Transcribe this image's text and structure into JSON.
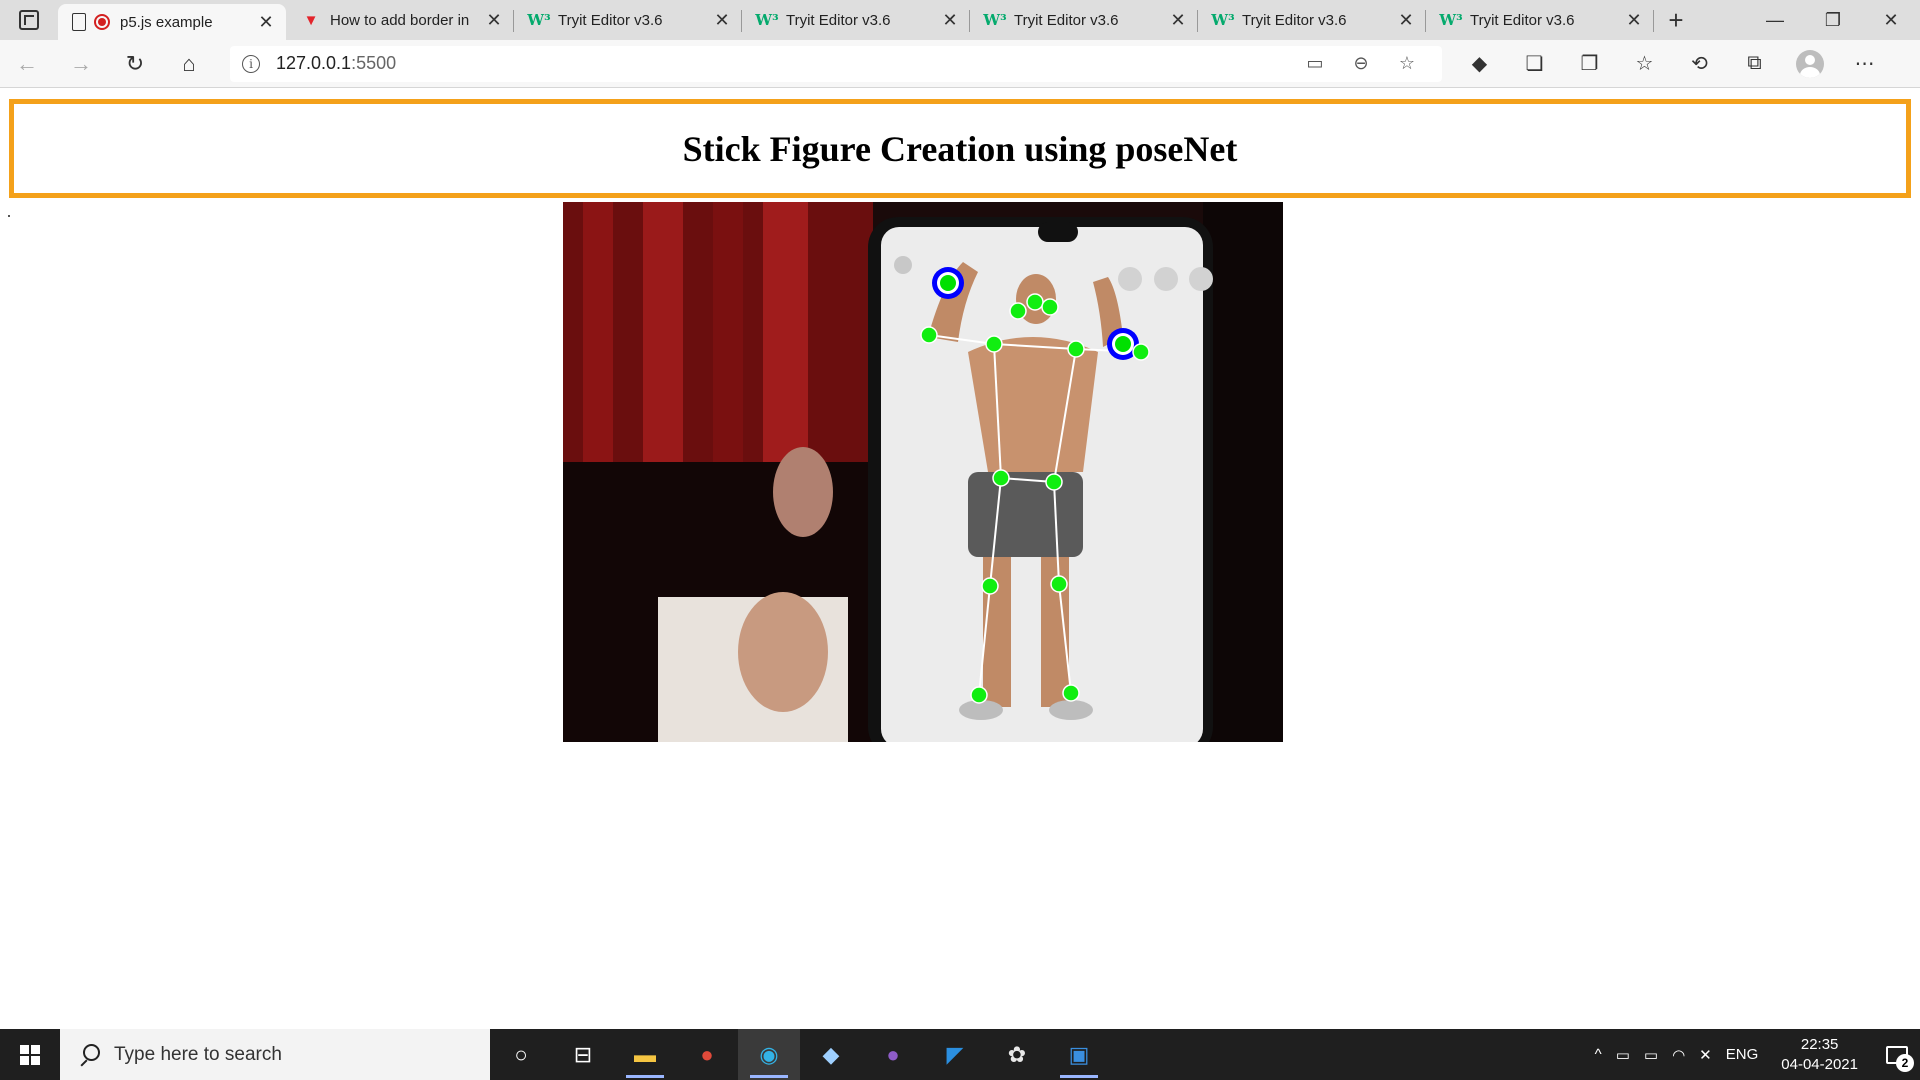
{
  "browser": {
    "tabs": [
      {
        "title": "p5.js example",
        "favicon": "recording-icon",
        "active": true
      },
      {
        "title": "How to add border in",
        "favicon": "vivaldi-icon",
        "active": false
      },
      {
        "title": "Tryit Editor v3.6",
        "favicon": "w3schools-icon",
        "active": false
      },
      {
        "title": "Tryit Editor v3.6",
        "favicon": "w3schools-icon",
        "active": false
      },
      {
        "title": "Tryit Editor v3.6",
        "favicon": "w3schools-icon",
        "active": false
      },
      {
        "title": "Tryit Editor v3.6",
        "favicon": "w3schools-icon",
        "active": false
      },
      {
        "title": "Tryit Editor v3.6",
        "favicon": "w3schools-icon",
        "active": false
      }
    ],
    "address": {
      "host": "127.0.0.1",
      "port": ":5500"
    }
  },
  "page": {
    "heading": "Stick Figure Creation using poseNet",
    "border_color": "#f4a11a"
  },
  "taskbar": {
    "search_placeholder": "Type here to search",
    "tray_lang": "ENG",
    "time": "22:35",
    "date": "04-04-2021",
    "notification_count": "2"
  }
}
